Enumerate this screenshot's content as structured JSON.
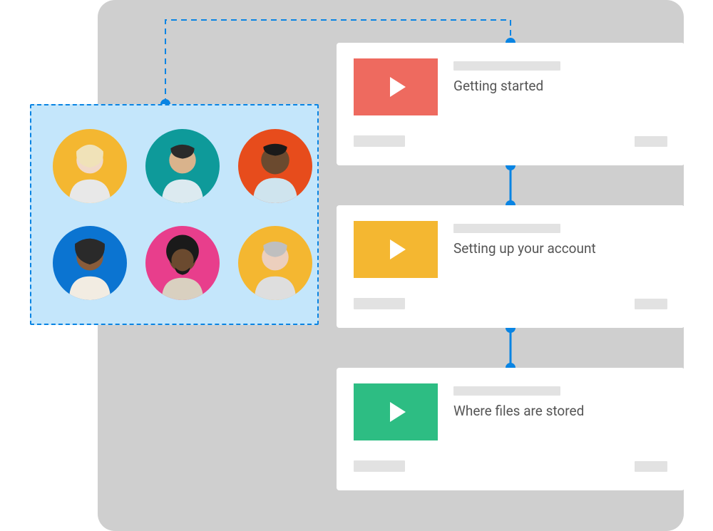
{
  "audience": {
    "avatars": [
      {
        "name": "avatar-1",
        "bg": "#f4b731"
      },
      {
        "name": "avatar-2",
        "bg": "#0e9a9a"
      },
      {
        "name": "avatar-3",
        "bg": "#e74c1c"
      },
      {
        "name": "avatar-4",
        "bg": "#0b74d1"
      },
      {
        "name": "avatar-5",
        "bg": "#e83e8c"
      },
      {
        "name": "avatar-6",
        "bg": "#f4b731"
      }
    ]
  },
  "cards": [
    {
      "title": "Getting started",
      "thumb_color": "#ee6a5f"
    },
    {
      "title": "Setting up your account",
      "thumb_color": "#f4b731"
    },
    {
      "title": "Where files are stored",
      "thumb_color": "#2dbd83"
    }
  ],
  "colors": {
    "connector": "#0984e3",
    "panel_bg": "#c4e6fb",
    "canvas_bg": "#cfcfcf"
  }
}
